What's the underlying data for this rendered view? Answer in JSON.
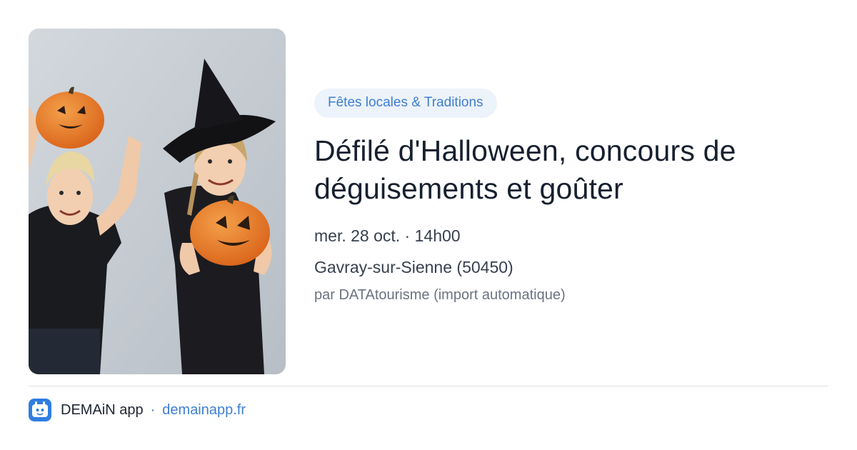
{
  "card": {
    "category_tag": "Fêtes locales & Traditions",
    "title": "Défilé d'Halloween, concours de déguisements et goûter",
    "date": "mer. 28 oct. · 14h00",
    "location": "Gavray-sur-Sienne (50450)",
    "source": "par DATAtourisme (import automatique)"
  },
  "footer": {
    "app_name": "DEMAiN app",
    "separator": "·",
    "domain": "demainapp.fr",
    "icon": "demain-app-logo-icon"
  },
  "colors": {
    "accent": "#3f7fd0",
    "tag_background": "#edf3fb",
    "title": "#17202f",
    "divider": "#d9dee5",
    "app_icon": "#2f7de1"
  }
}
